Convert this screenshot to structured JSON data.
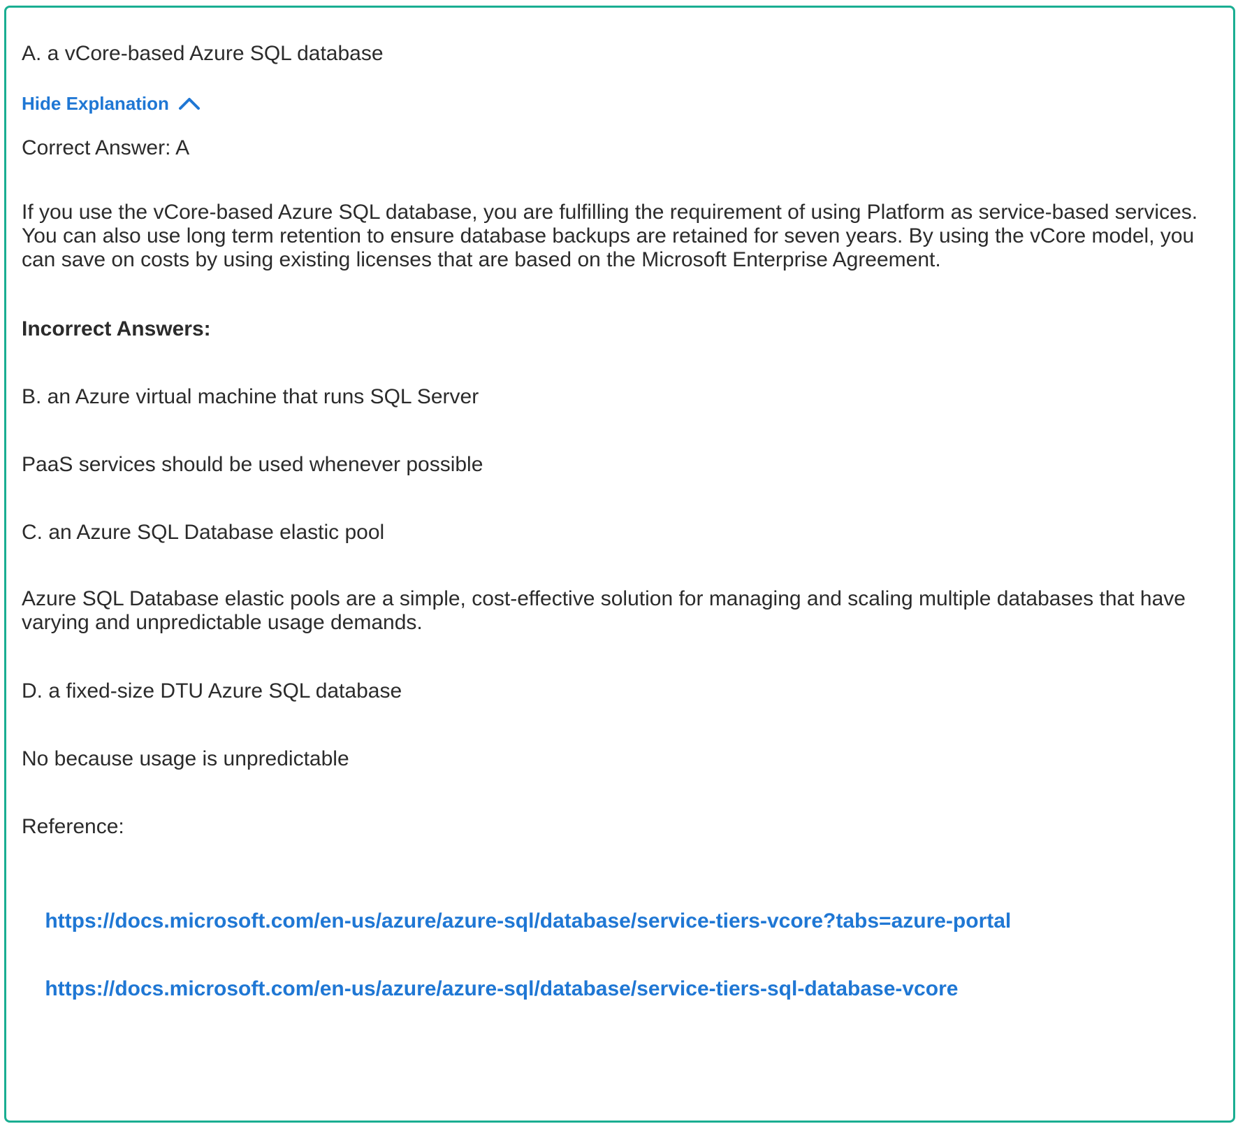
{
  "selected_option": "A. a vCore-based Azure SQL database",
  "toggle": {
    "label": "Hide Explanation",
    "icon": "chevron-up-icon"
  },
  "explanation": {
    "correct_answer": "Correct Answer: A",
    "correct_reason": "If you use the vCore-based Azure SQL database, you are fulfilling the requirement of using Platform as service-based services. You can also use long term retention to ensure database backups are retained for seven years. By using the vCore model, you can save on costs by using existing licenses that are based on the Microsoft Enterprise Agreement.",
    "incorrect_heading": "Incorrect Answers:",
    "option_b": "B. an Azure virtual machine that runs SQL Server",
    "option_b_reason": "PaaS services should be used whenever possible",
    "option_c": "C. an Azure SQL Database elastic pool",
    "option_c_reason": "Azure SQL Database elastic pools are a simple, cost-effective solution for managing and scaling multiple databases that have varying and unpredictable usage demands.",
    "option_d": "D. a fixed-size DTU Azure SQL database",
    "option_d_reason": "No because usage is unpredictable",
    "reference_label": "Reference:",
    "reference_links": [
      "https://docs.microsoft.com/en-us/azure/azure-sql/database/service-tiers-vcore?tabs=azure-portal",
      "https://docs.microsoft.com/en-us/azure/azure-sql/database/service-tiers-sql-database-vcore"
    ]
  },
  "colors": {
    "border": "#1aae92",
    "link": "#1f77d4",
    "text": "#2b2b2b"
  }
}
